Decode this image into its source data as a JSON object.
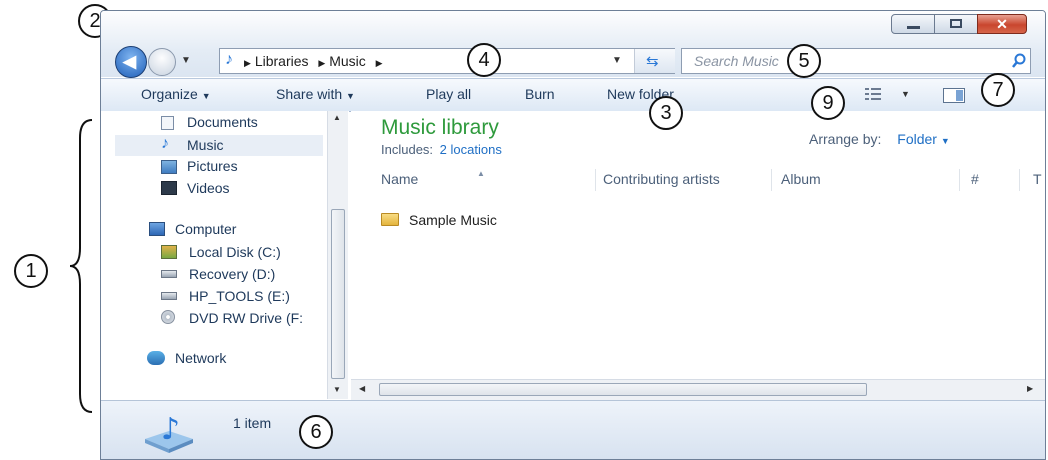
{
  "address": {
    "crumbs": [
      "Libraries",
      "Music"
    ],
    "search_placeholder": "Search Music"
  },
  "toolbar": {
    "organize": "Organize",
    "share_with": "Share with",
    "play_all": "Play all",
    "burn": "Burn",
    "new_folder": "New folder"
  },
  "nav": {
    "libraries": [
      "Documents",
      "Music",
      "Pictures",
      "Videos"
    ],
    "computer": "Computer",
    "drives": [
      "Local Disk (C:)",
      "Recovery (D:)",
      "HP_TOOLS (E:)",
      "DVD RW Drive (F:"
    ],
    "network": "Network"
  },
  "library": {
    "title": "Music library",
    "includes_label": "Includes:",
    "includes_link": "2 locations",
    "arrange_label": "Arrange by:",
    "arrange_value": "Folder"
  },
  "columns": [
    "Name",
    "Contributing artists",
    "Album",
    "#",
    "T"
  ],
  "items": [
    {
      "name": "Sample Music"
    }
  ],
  "status": {
    "count": "1 item"
  },
  "callouts": [
    "1",
    "2",
    "3",
    "4",
    "5",
    "6",
    "7",
    "9"
  ],
  "colors": {
    "accent": "#2e9a3c",
    "link": "#1f6fc5",
    "text": "#1e395b"
  }
}
